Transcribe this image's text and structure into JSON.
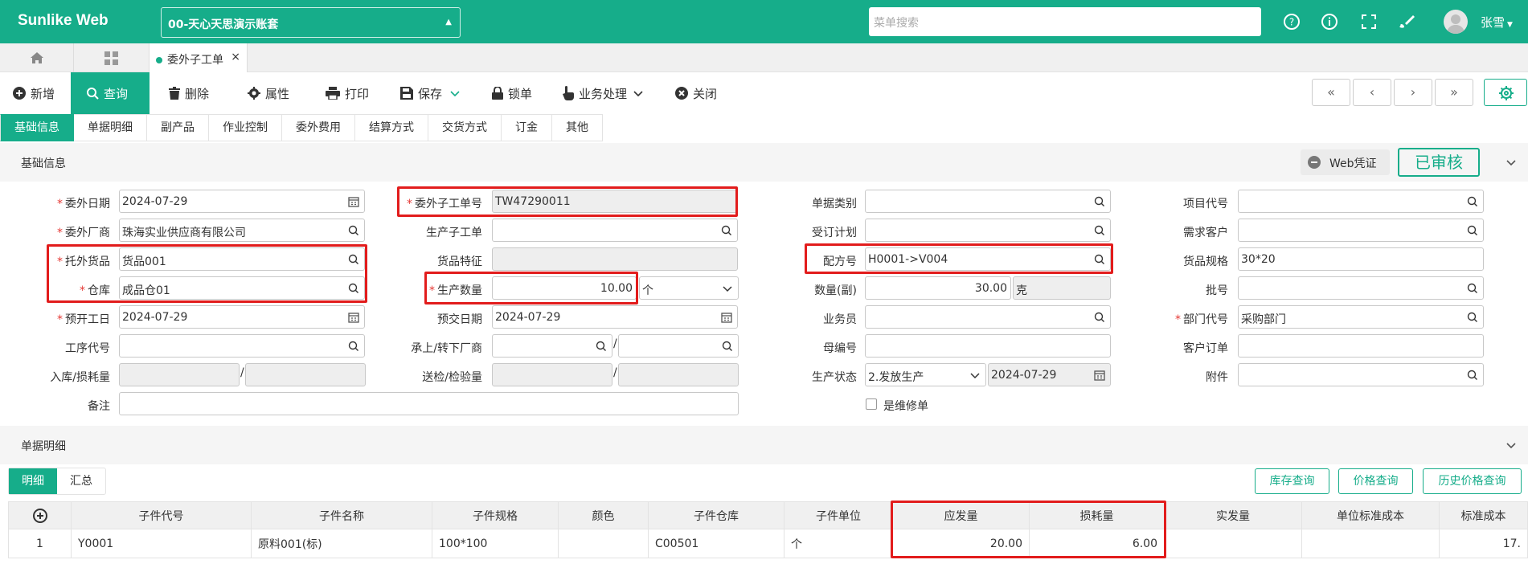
{
  "app": {
    "logo": "Sunlike Web",
    "account": "00-天心天思演示账套",
    "search_placeholder": "菜单搜索",
    "user": "张雪"
  },
  "tabs": {
    "doc_tab": "委外子工单",
    "close": "×"
  },
  "toolbar": {
    "new": "新增",
    "query": "查询",
    "delete": "删除",
    "properties": "属性",
    "print": "打印",
    "save": "保存",
    "lock": "锁单",
    "business": "业务处理",
    "close": "关闭",
    "nav": [
      "«",
      "‹",
      "›",
      "»"
    ]
  },
  "section_tabs": [
    "基础信息",
    "单据明细",
    "副产品",
    "作业控制",
    "委外费用",
    "结算方式",
    "交货方式",
    "订金",
    "其他"
  ],
  "basic": {
    "title": "基础信息",
    "web_voucher": "Web凭证",
    "status": "已审核"
  },
  "form": {
    "outsource_date": {
      "label": "委外日期",
      "value": "2024-07-29"
    },
    "vendor": {
      "label": "委外厂商",
      "value": "珠海实业供应商有限公司"
    },
    "goods": {
      "label": "托外货品",
      "value": "货品001"
    },
    "warehouse": {
      "label": "仓库",
      "value": "成品仓01"
    },
    "plan_start": {
      "label": "预开工日",
      "value": "2024-07-29"
    },
    "process_code": {
      "label": "工序代号",
      "value": ""
    },
    "in_loss": {
      "label": "入库/损耗量"
    },
    "remark": {
      "label": "备注",
      "value": ""
    },
    "sub_order_no": {
      "label": "委外子工单号",
      "value": "TW47290011"
    },
    "prod_sub_order": {
      "label": "生产子工单",
      "value": ""
    },
    "goods_feature": {
      "label": "货品特征",
      "value": ""
    },
    "prod_qty": {
      "label": "生产数量",
      "value": "10.00",
      "unit": "个"
    },
    "delivery_date": {
      "label": "预交日期",
      "value": "2024-07-29"
    },
    "transfer_vendor": {
      "label": "承上/转下厂商"
    },
    "inspect_qty": {
      "label": "送检/检验量"
    },
    "doc_category": {
      "label": "单据类别",
      "value": ""
    },
    "order_plan": {
      "label": "受订计划",
      "value": ""
    },
    "formula_no": {
      "label": "配方号",
      "value": "H0001->V004"
    },
    "qty_sub": {
      "label": "数量(副)",
      "value": "30.00",
      "unit": "克"
    },
    "salesman": {
      "label": "业务员",
      "value": ""
    },
    "parent_no": {
      "label": "母编号",
      "value": ""
    },
    "prod_status": {
      "label": "生产状态",
      "value": "2.发放生产",
      "date": "2024-07-29"
    },
    "is_repair": {
      "label": "是维修单"
    },
    "project_code": {
      "label": "项目代号",
      "value": ""
    },
    "demand_customer": {
      "label": "需求客户",
      "value": ""
    },
    "goods_spec": {
      "label": "货品规格",
      "value": "30*20"
    },
    "batch_no": {
      "label": "批号",
      "value": ""
    },
    "dept_code": {
      "label": "部门代号",
      "value": "采购部门"
    },
    "customer_order": {
      "label": "客户订单",
      "value": ""
    },
    "attachment": {
      "label": "附件",
      "value": ""
    },
    "slash": "/"
  },
  "detail": {
    "title": "单据明细",
    "tabs": [
      "明细",
      "汇总"
    ],
    "buttons": [
      "库存查询",
      "价格查询",
      "历史价格查询"
    ],
    "columns": [
      "子件代号",
      "子件名称",
      "子件规格",
      "颜色",
      "子件仓库",
      "子件单位",
      "应发量",
      "损耗量",
      "实发量",
      "单位标准成本",
      "标准成本"
    ],
    "rows": [
      {
        "no": "1",
        "code": "Y0001",
        "name": "原料001(标)",
        "spec": "100*100",
        "color": "",
        "warehouse": "C00501",
        "unit": "个",
        "issue_qty": "20.00",
        "loss_qty": "6.00",
        "actual_qty": "",
        "unit_cost": "",
        "std_cost": "17."
      }
    ]
  },
  "colors": {
    "brand": "#16ad8a",
    "highlight": "#e21c1c"
  }
}
